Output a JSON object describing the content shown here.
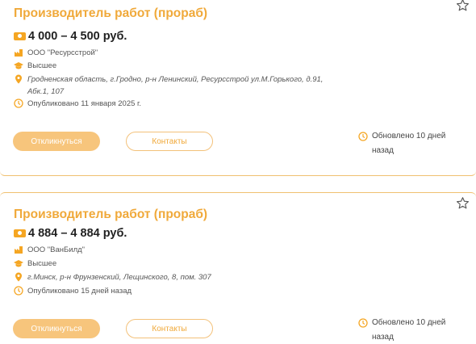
{
  "colors": {
    "accent": "#f0a93a",
    "icon": "#f5a623",
    "button_fill": "#f7c57c"
  },
  "vacancies": [
    {
      "title": "Производитель работ (прораб)",
      "salary": "4 000 – 4 500 руб.",
      "company": "ООО \"Ресурсстрой\"",
      "education": "Высшее",
      "address": "Гродненская область, г.Гродно, р-н Ленинский, Ресурсстрой ул.М.Горького, д.91, Абк.1, 107",
      "published": "Опубликовано 11 января 2025 г.",
      "apply_label": "Откликнуться",
      "contacts_label": "Контакты",
      "updated": "Обновлено 10 дней назад"
    },
    {
      "title": "Производитель работ (прораб)",
      "salary": "4 884 – 4 884 руб.",
      "company": "ООО \"ВанБилд\"",
      "education": "Высшее",
      "address": "г.Минск, р-н Фрунзенский, Лещинского, 8, пом. 307",
      "published": "Опубликовано 15 дней назад",
      "apply_label": "Откликнуться",
      "contacts_label": "Контакты",
      "updated": "Обновлено 10 дней назад"
    }
  ],
  "icons": [
    "star-icon",
    "money-icon",
    "company-icon",
    "education-icon",
    "location-icon",
    "clock-icon"
  ]
}
